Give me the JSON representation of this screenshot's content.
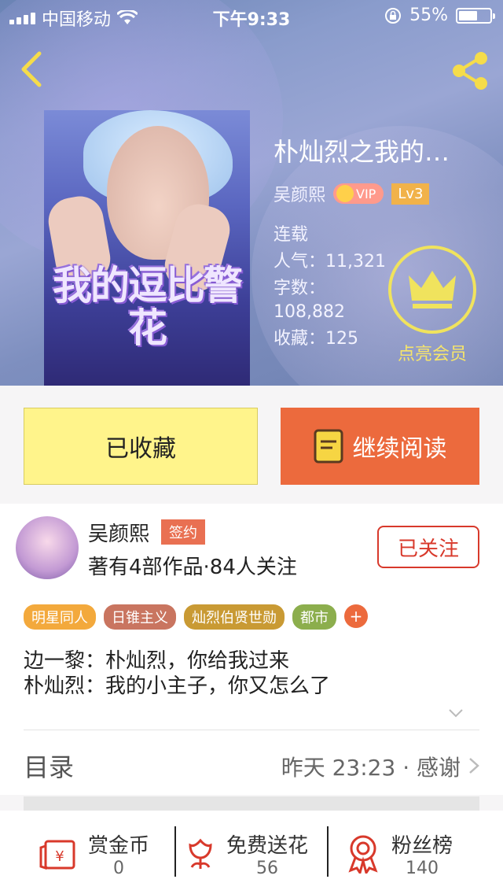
{
  "status": {
    "carrier": "中国移动",
    "time": "下午9:33",
    "battery": "55%"
  },
  "book": {
    "title": "朴灿烈之我的…",
    "author": "吴颜熙",
    "vip": "VIP",
    "level": "Lv3",
    "status": "连载",
    "popularity": "人气：11,321",
    "word_label": "字数：",
    "word_count": "108,882",
    "favorites": "收藏：125",
    "cover_title": "我的逗比警花",
    "member_label": "点亮会员"
  },
  "actions": {
    "favorite": "已收藏",
    "read": "继续阅读"
  },
  "author_card": {
    "name": "吴颜熙",
    "badge": "签约",
    "meta": "著有4部作品·84人关注",
    "follow": "已关注"
  },
  "tags": [
    {
      "label": "明星同人",
      "color": "#f3a93c"
    },
    {
      "label": "日锥主义",
      "color": "#c97560"
    },
    {
      "label": "灿烈伯贤世勋",
      "color": "#c99a34"
    },
    {
      "label": "都市",
      "color": "#8cae4d"
    }
  ],
  "tag_plus": "+",
  "description": [
    "边一黎：朴灿烈，你给我过来",
    "朴灿烈：我的小主子，你又怎么了"
  ],
  "toc": {
    "label": "目录",
    "updated": "昨天 23:23 · 感谢"
  },
  "stats": [
    {
      "label": "赏金币",
      "value": "0"
    },
    {
      "label": "免费送花",
      "value": "56"
    },
    {
      "label": "粉丝榜",
      "value": "140"
    }
  ]
}
